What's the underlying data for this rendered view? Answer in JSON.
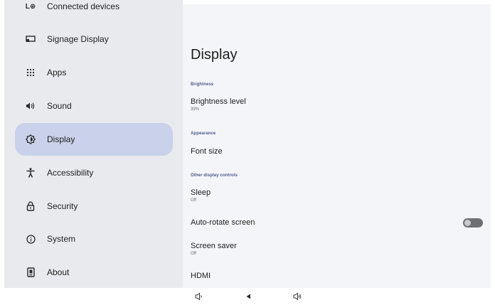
{
  "sidebar": {
    "items": [
      {
        "label": "Connected devices",
        "icon": "connected-devices-icon"
      },
      {
        "label": "Signage Display",
        "icon": "signage-display-icon"
      },
      {
        "label": "Apps",
        "icon": "apps-grid-icon"
      },
      {
        "label": "Sound",
        "icon": "speaker-icon"
      },
      {
        "label": "Display",
        "icon": "brightness-icon",
        "selected": true
      },
      {
        "label": "Accessibility",
        "icon": "accessibility-icon"
      },
      {
        "label": "Security",
        "icon": "lock-icon"
      },
      {
        "label": "System",
        "icon": "info-icon"
      },
      {
        "label": "About",
        "icon": "device-icon"
      }
    ],
    "connected_icon_glyph": "L⊕"
  },
  "main": {
    "title": "Display",
    "sections": [
      {
        "header": "Brightness",
        "items": [
          {
            "title": "Brightness level",
            "summary": "39%"
          }
        ]
      },
      {
        "header": "Appearance",
        "items": [
          {
            "title": "Font size"
          }
        ]
      },
      {
        "header": "Other display controls",
        "items": [
          {
            "title": "Sleep",
            "summary": "Off"
          },
          {
            "title": "Auto-rotate screen",
            "toggle": false
          },
          {
            "title": "Screen saver",
            "summary": "Off"
          },
          {
            "title": "HDMI"
          }
        ]
      }
    ]
  },
  "navbar": {
    "buttons": [
      "volume-down-icon",
      "back-icon",
      "volume-up-icon"
    ]
  },
  "colors": {
    "sidebar_bg": "#e9eaee",
    "selected_bg": "#c9d2ea",
    "main_bg": "#f4f5f9",
    "section_header": "#4a5a8a",
    "toggle_track": "#6e6f73"
  }
}
